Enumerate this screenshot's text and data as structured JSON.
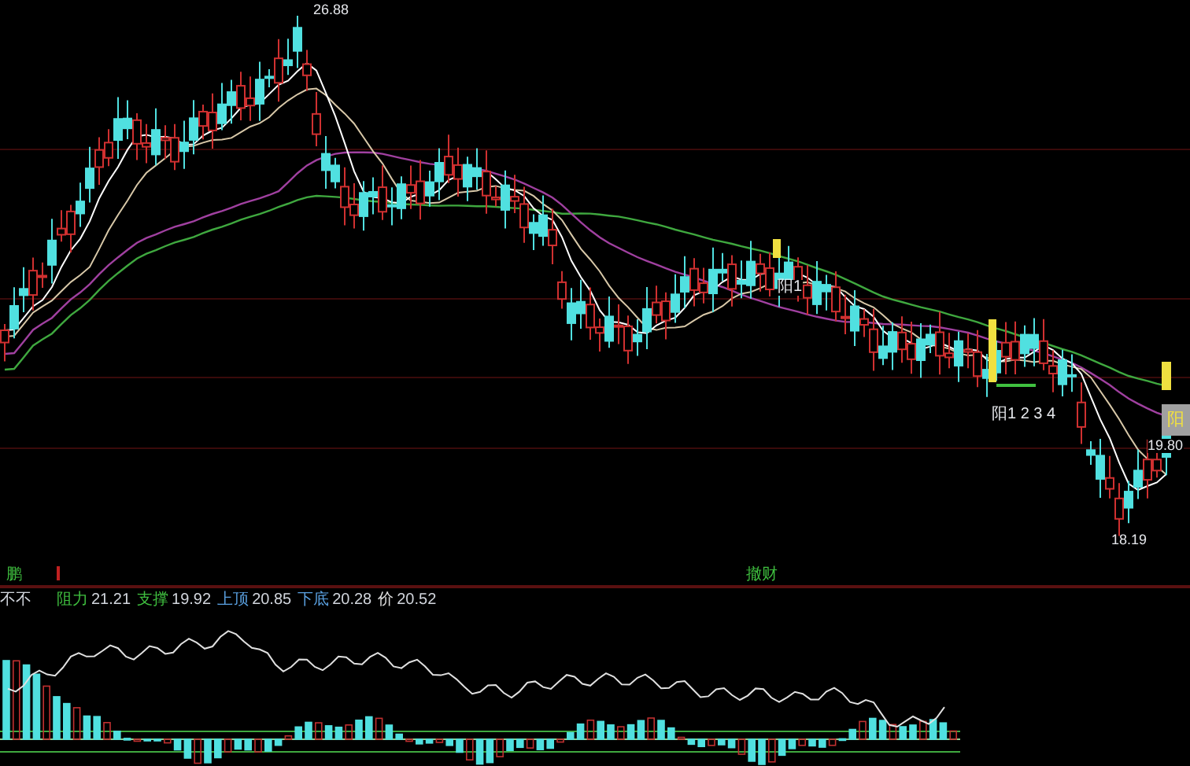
{
  "main_chart": {
    "high_label": "26.88",
    "low_label": "18.19",
    "last_label": "19.80",
    "box_label": "阳",
    "signals": [
      {
        "text": "阳1"
      },
      {
        "text": "阳1 2 3 4"
      }
    ]
  },
  "markers": [
    {
      "text": "鹏"
    },
    {
      "text": "撤财"
    }
  ],
  "indicator": {
    "name": "不不",
    "values": [
      {
        "label": "阻力",
        "value": "21.21",
        "color": "#3fbf3f"
      },
      {
        "label": "支撑",
        "value": "19.92",
        "color": "#3fbf3f"
      },
      {
        "label": "上顶",
        "value": "20.85",
        "color": "#5aa0e0"
      },
      {
        "label": "下底",
        "value": "20.28",
        "color": "#5aa0e0"
      },
      {
        "label": "价",
        "value": "20.52",
        "color": "#e0e0e0"
      }
    ]
  }
}
